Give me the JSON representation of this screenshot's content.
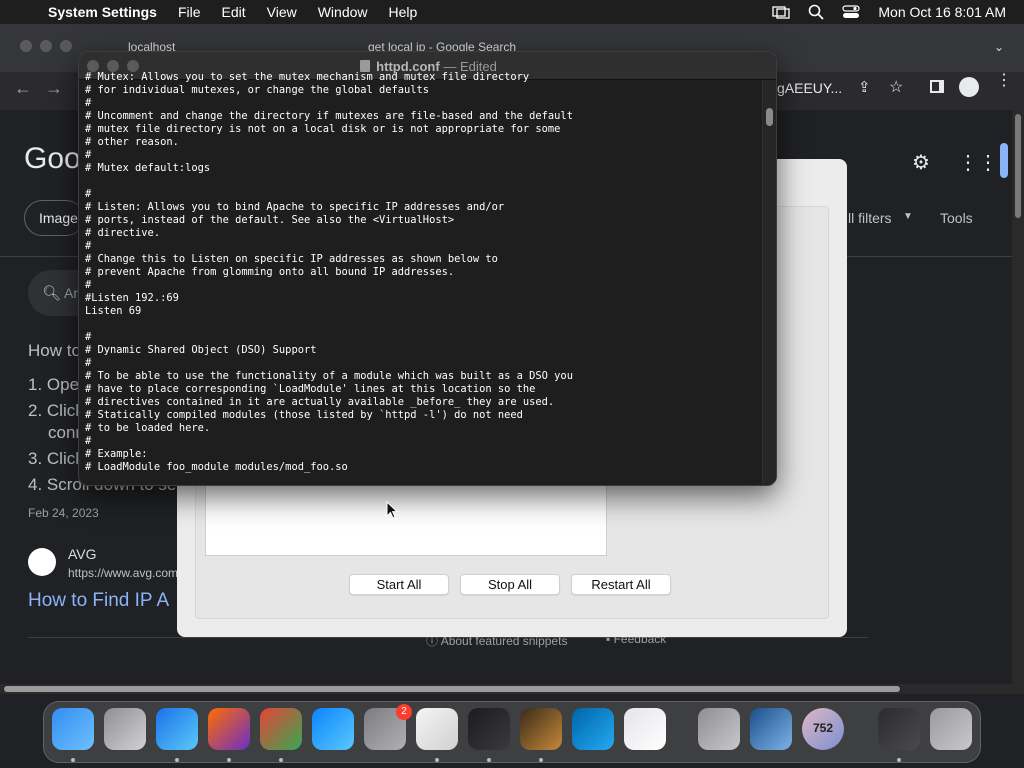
{
  "menubar": {
    "app_name": "System Settings",
    "menus": [
      "File",
      "Edit",
      "View",
      "Window",
      "Help"
    ],
    "clock": "Mon Oct 16  8:01 AM"
  },
  "chrome": {
    "tabs": [
      "localhost",
      "get local ip - Google Search"
    ],
    "address_fragment": "gAEEUY...",
    "google_logo": "Goo",
    "images_chip": "Image",
    "all_filters": "ll filters",
    "tools": "Tools",
    "search_placeholder": "Ar",
    "how_to_heading": "How to",
    "steps": [
      "1. Ope",
      "2. Click",
      "conn",
      "3. Click",
      "4. Scroll down to see"
    ],
    "date": "Feb 24, 2023",
    "source_name": "AVG",
    "source_url": "https://www.avg.com",
    "result_link": "How to Find IP A",
    "about_snippets": "About featured snippets",
    "feedback": "Feedback"
  },
  "panel": {
    "buttons": [
      "Start All",
      "Stop All",
      "Restart All"
    ]
  },
  "editor": {
    "filename": "httpd.conf",
    "status": "Edited",
    "lines": [
      "# Mutex: Allows you to set the mutex mechanism and mutex file directory",
      "# for individual mutexes, or change the global defaults",
      "#",
      "# Uncomment and change the directory if mutexes are file-based and the default",
      "# mutex file directory is not on a local disk or is not appropriate for some",
      "# other reason.",
      "#",
      "# Mutex default:logs",
      "",
      "#",
      "# Listen: Allows you to bind Apache to specific IP addresses and/or",
      "# ports, instead of the default. See also the <VirtualHost>",
      "# directive.",
      "#",
      "# Change this to Listen on specific IP addresses as shown below to",
      "# prevent Apache from glomming onto all bound IP addresses.",
      "#",
      "#Listen 192.:69",
      "Listen 69",
      "",
      "#",
      "# Dynamic Shared Object (DSO) Support",
      "#",
      "# To be able to use the functionality of a module which was built as a DSO you",
      "# have to place corresponding `LoadModule' lines at this location so the",
      "# directives contained in it are actually available _before_ they are used.",
      "# Statically compiled modules (those listed by `httpd -l') do not need",
      "# to be loaded here.",
      "#",
      "# Example:",
      "# LoadModule foo_module modules/mod_foo.so"
    ]
  },
  "dock": {
    "apps": [
      "Finder",
      "Launchpad",
      "Safari",
      "Firefox",
      "Chrome",
      "App Store",
      "System Settings",
      "TextEdit",
      "Terminal",
      "GarageBand",
      "VS Code",
      "Roblox",
      "Preferences",
      "VirtualBox",
      "Counter",
      "Activity",
      "Trash"
    ],
    "settings_badge": "2",
    "counter_label": "752"
  },
  "colors": {
    "editor_bg": "#1e1e1e",
    "menubar_bg": "#1e1e1e",
    "link_blue": "#8ab4f8"
  }
}
